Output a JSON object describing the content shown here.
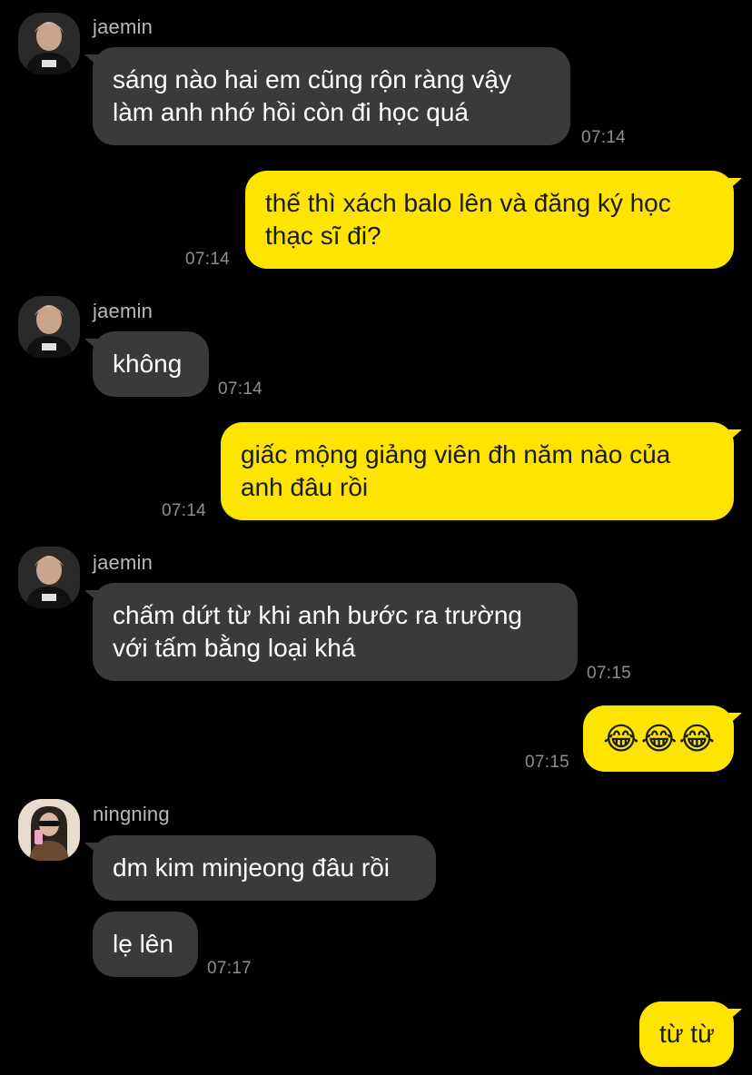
{
  "conversation": [
    {
      "sender": "jaemin",
      "bubbles": [
        {
          "lines": [
            "sáng nào hai em cũng rộn ràng vậy",
            "làm anh nhớ hồi còn đi học quá"
          ],
          "time": "07:14"
        }
      ]
    },
    {
      "sender": "me",
      "bubbles": [
        {
          "lines": [
            "thế thì xách balo lên và đăng ký học",
            "thạc sĩ đi?"
          ],
          "time": "07:14"
        }
      ]
    },
    {
      "sender": "jaemin",
      "bubbles": [
        {
          "lines": [
            "không"
          ],
          "time": "07:14"
        }
      ]
    },
    {
      "sender": "me",
      "bubbles": [
        {
          "lines": [
            "giấc mộng giảng viên đh năm nào của",
            "anh đâu rồi"
          ],
          "time": "07:14"
        }
      ]
    },
    {
      "sender": "jaemin",
      "bubbles": [
        {
          "lines": [
            "chấm dứt từ khi anh bước ra trường",
            "với tấm bằng loại khá"
          ],
          "time": "07:15"
        }
      ]
    },
    {
      "sender": "me",
      "bubbles": [
        {
          "lines": [
            "😂😂😂"
          ],
          "time": "07:15"
        }
      ]
    },
    {
      "sender": "ningning",
      "bubbles": [
        {
          "lines": [
            "dm kim minjeong đâu rồi"
          ],
          "time": ""
        },
        {
          "lines": [
            "lẹ lên"
          ],
          "time": "07:17"
        }
      ]
    },
    {
      "sender": "me",
      "bubbles": [
        {
          "lines": [
            "từ từ"
          ],
          "time": ""
        }
      ]
    }
  ],
  "icons": {
    "jaemin_avatar": "avatar-jaemin-icon",
    "ningning_avatar": "avatar-ningning-icon"
  },
  "colors": {
    "background": "#000000",
    "incoming_bubble": "#3a3a3c",
    "outgoing_bubble": "#fee500",
    "timestamp": "#8e8e93",
    "sender_name": "#b9b9b9"
  }
}
